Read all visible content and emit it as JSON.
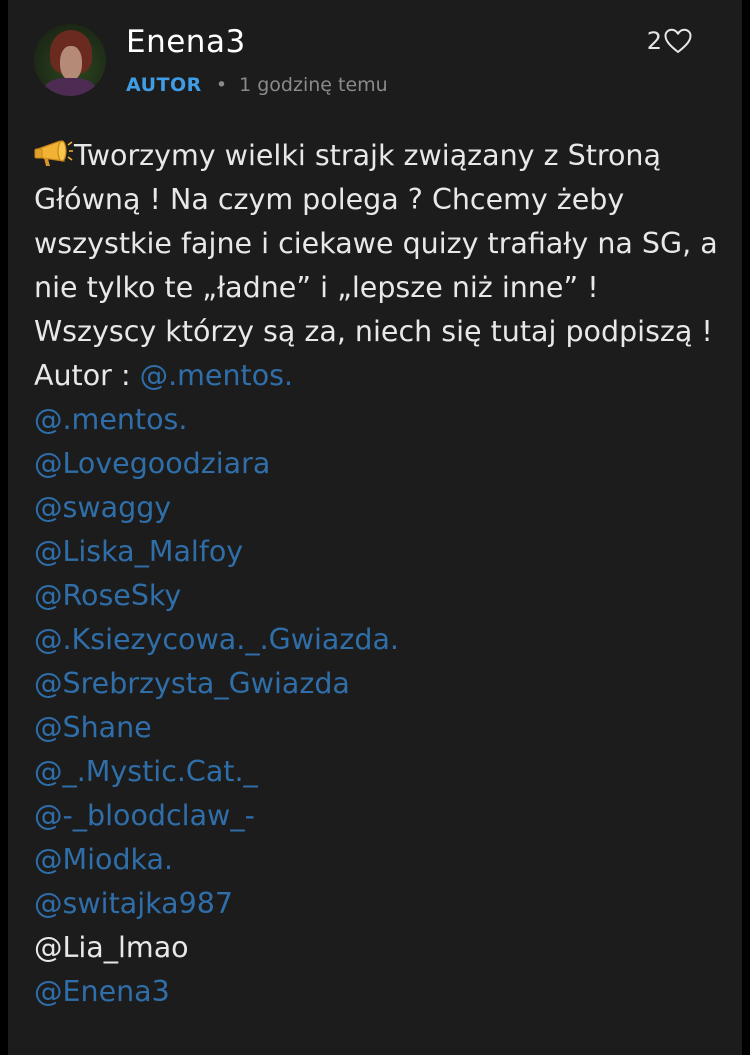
{
  "comment": {
    "author": "Enena3",
    "badge": "AUTOR",
    "separator": "•",
    "time": "1 godzinę temu",
    "likes": "2",
    "body_icon": "megaphone-icon",
    "body_text": "Tworzymy wielki strajk związany z Stroną Główną ! Na czym polega ? Chcemy żeby wszystkie fajne i ciekawe quizy trafiały na SG, a nie tylko te „ładne” i „lepsze niż inne” ! Wszyscy którzy są za, niech się tutaj podpiszą !",
    "author_label": "Autor : ",
    "author_mention": "@.mentos.",
    "mentions": [
      "@.mentos.",
      "@Lovegoodziara",
      "@swaggy",
      "@Liska_Malfoy",
      "@RoseSky",
      "@.Ksiezycowa._.Gwiazda.",
      "@Srebrzysta_Gwiazda",
      "@Shane",
      "@_.Mystic.Cat._",
      "@-_bloodclaw_-",
      "@Miodka.",
      "@switajka987",
      "@Lia_lmao",
      "@Enena3"
    ]
  },
  "colors": {
    "background": "#1c1c1c",
    "badge": "#3f9de6",
    "mention": "#2f6ea8",
    "text": "#e8e8e8",
    "meta": "#8a8a8a"
  }
}
